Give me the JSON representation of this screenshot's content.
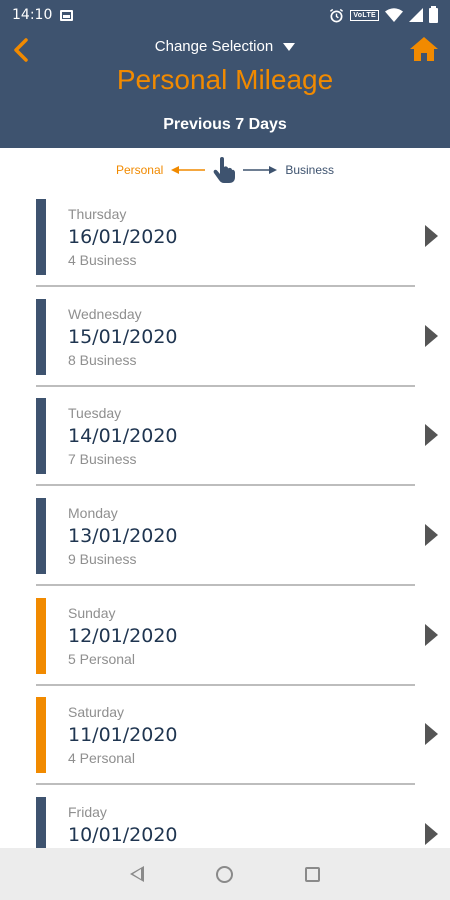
{
  "status_bar": {
    "time": "14:10",
    "network_label": "VoLTE"
  },
  "header": {
    "change_selection_label": "Change Selection",
    "title": "Personal Mileage",
    "period": "Previous 7 Days"
  },
  "legend": {
    "personal_label": "Personal",
    "business_label": "Business"
  },
  "colors": {
    "header_bg": "#3e536f",
    "accent": "#f18a00",
    "business": "#3e536f",
    "personal": "#f18a00"
  },
  "journeys": [
    {
      "day": "Thursday",
      "date": "16/01/2020",
      "count": "4 Business",
      "type": "business"
    },
    {
      "day": "Wednesday",
      "date": "15/01/2020",
      "count": "8 Business",
      "type": "business"
    },
    {
      "day": "Tuesday",
      "date": "14/01/2020",
      "count": "7 Business",
      "type": "business"
    },
    {
      "day": "Monday",
      "date": "13/01/2020",
      "count": "9 Business",
      "type": "business"
    },
    {
      "day": "Sunday",
      "date": "12/01/2020",
      "count": "5 Personal",
      "type": "personal"
    },
    {
      "day": "Saturday",
      "date": "11/01/2020",
      "count": "4 Personal",
      "type": "personal"
    },
    {
      "day": "Friday",
      "date": "10/01/2020",
      "count": "",
      "type": "business"
    }
  ],
  "icons": {
    "back": "chevron-left-icon",
    "home": "home-icon",
    "swipe": "hand-pointer-icon",
    "row_arrow": "chevron-right-icon"
  }
}
